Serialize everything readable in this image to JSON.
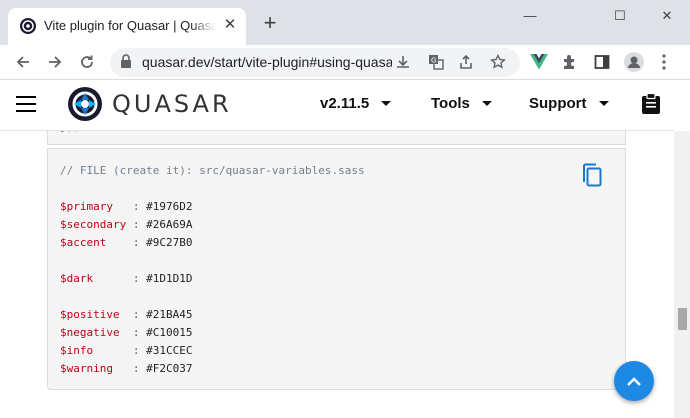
{
  "browser": {
    "tab_title": "Vite plugin for Quasar | Quasar Framework",
    "url": "quasar.dev/start/vite-plugin#using-quasar-variables",
    "new_tab_glyph": "+",
    "close_tab_glyph": "✕",
    "minimize_glyph": "—",
    "maximize_glyph": "☐",
    "close_window_glyph": "✕"
  },
  "header": {
    "brand": "QUASAR",
    "nav": [
      {
        "label": "v2.11.5"
      },
      {
        "label": "Tools"
      },
      {
        "label": "Support"
      }
    ]
  },
  "code": {
    "top_fragment": "});",
    "comment": "// FILE (create it): src/quasar-variables.sass",
    "groups": [
      [
        {
          "name": "$primary  ",
          "value": "#1976D2"
        },
        {
          "name": "$secondary",
          "value": "#26A69A"
        },
        {
          "name": "$accent   ",
          "value": "#9C27B0"
        }
      ],
      [
        {
          "name": "$dark     ",
          "value": "#1D1D1D"
        }
      ],
      [
        {
          "name": "$positive ",
          "value": "#21BA45"
        },
        {
          "name": "$negative ",
          "value": "#C10015"
        },
        {
          "name": "$info     ",
          "value": "#31CCEC"
        },
        {
          "name": "$warning  ",
          "value": "#F2C037"
        }
      ]
    ],
    "separator": " : "
  },
  "colors": {
    "variable": "#c10015",
    "comment": "#708090",
    "fab": "#1e88e5",
    "vue_icon": "#41b883"
  }
}
